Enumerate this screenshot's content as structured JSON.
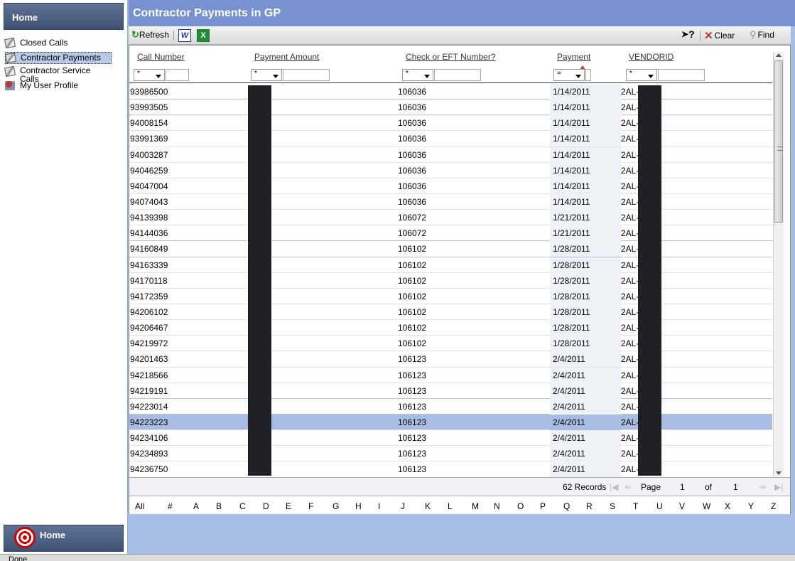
{
  "nav": {
    "home_top": "Home",
    "home_bottom": "Home",
    "items": [
      {
        "label": "Closed Calls"
      },
      {
        "label": "Contractor Payments"
      },
      {
        "label": "Contractor Service Calls"
      },
      {
        "label": "My User Profile"
      }
    ]
  },
  "page": {
    "title": "Contractor Payments in GP"
  },
  "toolbar": {
    "refresh": "Refresh",
    "clear": "Clear",
    "find": "Find",
    "word_icon": "W",
    "excel_icon": "X",
    "help_icon": "?"
  },
  "grid": {
    "columns": [
      "Call Number",
      "Payment Amount",
      "Check or EFT Number?",
      "Payment",
      "VENDORID"
    ],
    "filters": [
      "*",
      "*",
      "*",
      "=",
      "*"
    ],
    "rows": [
      {
        "call": "93986500",
        "check": "106036",
        "date": "1/14/2011",
        "vendor": "2AL-"
      },
      {
        "call": "93993505",
        "check": "106036",
        "date": "1/14/2011",
        "vendor": "2AL-"
      },
      {
        "call": "94008154",
        "check": "106036",
        "date": "1/14/2011",
        "vendor": "2AL-"
      },
      {
        "call": "93991369",
        "check": "106036",
        "date": "1/14/2011",
        "vendor": "2AL-"
      },
      {
        "call": "94003287",
        "check": "106036",
        "date": "1/14/2011",
        "vendor": "2AL-"
      },
      {
        "call": "94046259",
        "check": "106036",
        "date": "1/14/2011",
        "vendor": "2AL-"
      },
      {
        "call": "94047004",
        "check": "106036",
        "date": "1/14/2011",
        "vendor": "2AL-"
      },
      {
        "call": "94074043",
        "check": "106036",
        "date": "1/14/2011",
        "vendor": "2AL-"
      },
      {
        "call": "94139398",
        "check": "106072",
        "date": "1/21/2011",
        "vendor": "2AL-"
      },
      {
        "call": "94144036",
        "check": "106072",
        "date": "1/21/2011",
        "vendor": "2AL-"
      },
      {
        "call": "94160849",
        "check": "106102",
        "date": "1/28/2011",
        "vendor": "2AL-"
      },
      {
        "call": "94163339",
        "check": "106102",
        "date": "1/28/2011",
        "vendor": "2AL-"
      },
      {
        "call": "94170118",
        "check": "106102",
        "date": "1/28/2011",
        "vendor": "2AL-"
      },
      {
        "call": "94172359",
        "check": "106102",
        "date": "1/28/2011",
        "vendor": "2AL-"
      },
      {
        "call": "94206102",
        "check": "106102",
        "date": "1/28/2011",
        "vendor": "2AL-"
      },
      {
        "call": "94206467",
        "check": "106102",
        "date": "1/28/2011",
        "vendor": "2AL-"
      },
      {
        "call": "94219972",
        "check": "106102",
        "date": "1/28/2011",
        "vendor": "2AL-"
      },
      {
        "call": "94201463",
        "check": "106123",
        "date": "2/4/2011",
        "vendor": "2AL-"
      },
      {
        "call": "94218566",
        "check": "106123",
        "date": "2/4/2011",
        "vendor": "2AL-"
      },
      {
        "call": "94219191",
        "check": "106123",
        "date": "2/4/2011",
        "vendor": "2AL-"
      },
      {
        "call": "94223014",
        "check": "106123",
        "date": "2/4/2011",
        "vendor": "2AL-"
      },
      {
        "call": "94223223",
        "check": "106123",
        "date": "2/4/2011",
        "vendor": "2AL-"
      },
      {
        "call": "94234106",
        "check": "106123",
        "date": "2/4/2011",
        "vendor": "2AL-"
      },
      {
        "call": "94234893",
        "check": "106123",
        "date": "2/4/2011",
        "vendor": "2AL-"
      },
      {
        "call": "94236750",
        "check": "106123",
        "date": "2/4/2011",
        "vendor": "2AL-"
      }
    ],
    "selected_row": 21
  },
  "pager": {
    "records": "62 Records",
    "page_label": "Page",
    "page": "1",
    "of_label": "of",
    "total": "1"
  },
  "alpha": [
    "All",
    "#",
    "A",
    "B",
    "C",
    "D",
    "E",
    "F",
    "G",
    "H",
    "I",
    "J",
    "K",
    "L",
    "M",
    "N",
    "O",
    "P",
    "Q",
    "R",
    "S",
    "T",
    "U",
    "V",
    "W",
    "X",
    "Y",
    "Z"
  ],
  "status": "Done",
  "colors": {
    "title_bg": "#7891d0",
    "selected_row": "#a9bde3",
    "redaction": "#1f2126"
  }
}
